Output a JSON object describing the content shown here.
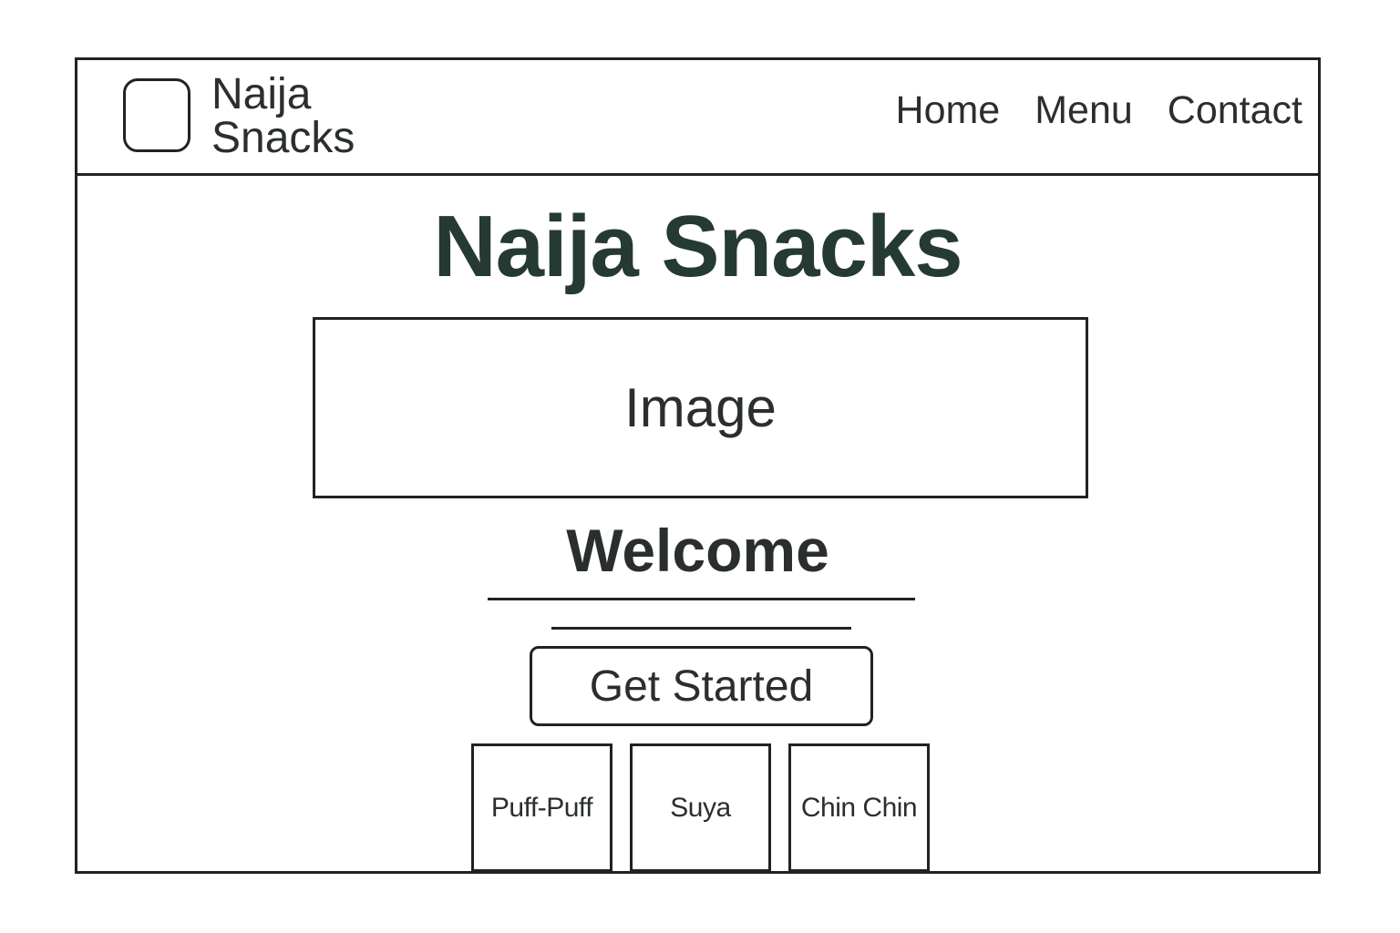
{
  "header": {
    "logo_icon": "rounded-square-logo-icon",
    "brand_line1": "Naija",
    "brand_line2": "Snacks",
    "nav": [
      {
        "label": "Home"
      },
      {
        "label": "Menu"
      },
      {
        "label": "Contact"
      }
    ]
  },
  "main": {
    "title": "Naija Snacks",
    "image_placeholder": "Image",
    "welcome": "Welcome",
    "cta_label": "Get Started",
    "snacks": [
      {
        "label": "Puff-Puff"
      },
      {
        "label": "Suya"
      },
      {
        "label": "Chin Chin"
      }
    ]
  },
  "colors": {
    "title": "#253a30",
    "text": "#2a2f2c",
    "border": "#222222",
    "background": "#ffffff"
  }
}
